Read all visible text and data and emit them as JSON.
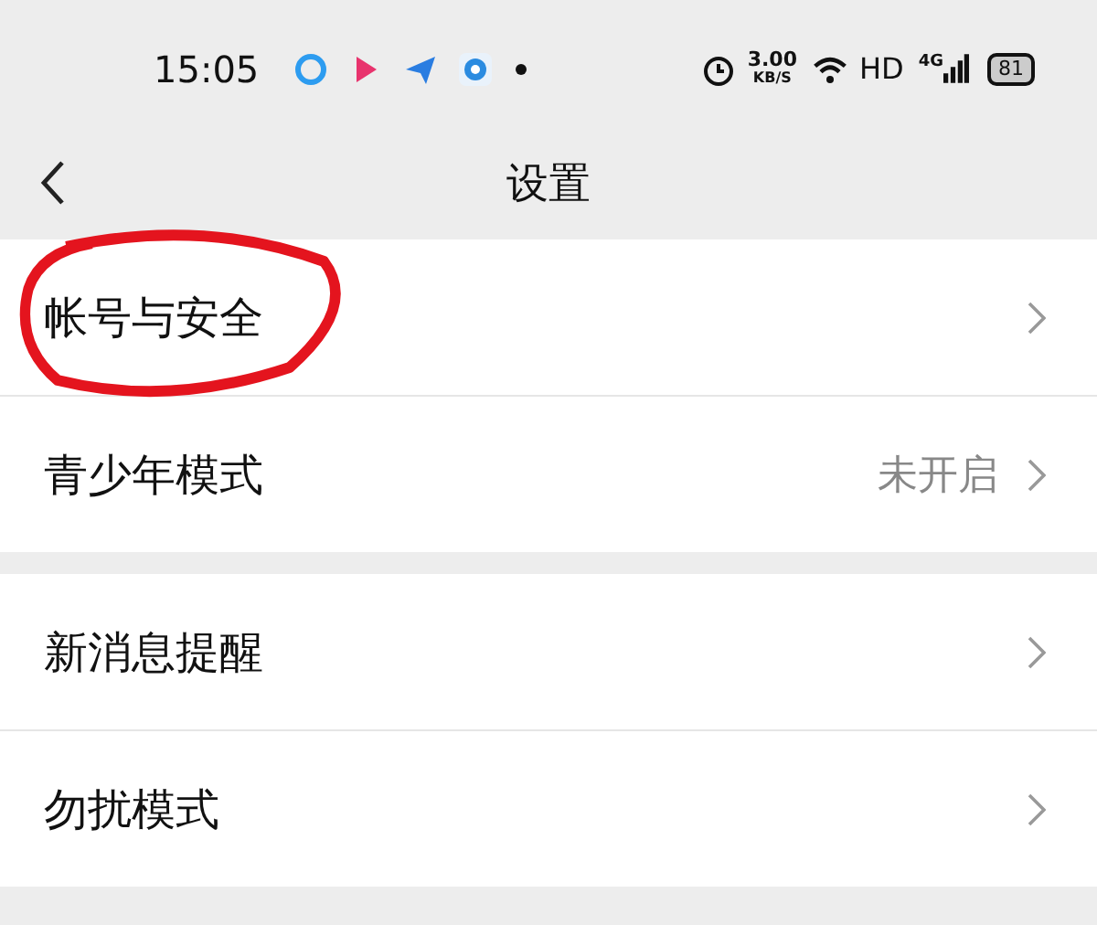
{
  "status_bar": {
    "time": "15:05",
    "speed": "3.00",
    "speed_unit": "KB/S",
    "hd": "HD",
    "network": "4G",
    "battery": "81"
  },
  "header": {
    "title": "设置"
  },
  "groups": [
    {
      "items": [
        {
          "label": "帐号与安全",
          "value": "",
          "circled": true
        },
        {
          "label": "青少年模式",
          "value": "未开启",
          "circled": false
        }
      ]
    },
    {
      "items": [
        {
          "label": "新消息提醒",
          "value": "",
          "circled": false
        },
        {
          "label": "勿扰模式",
          "value": "",
          "circled": false
        }
      ]
    }
  ]
}
